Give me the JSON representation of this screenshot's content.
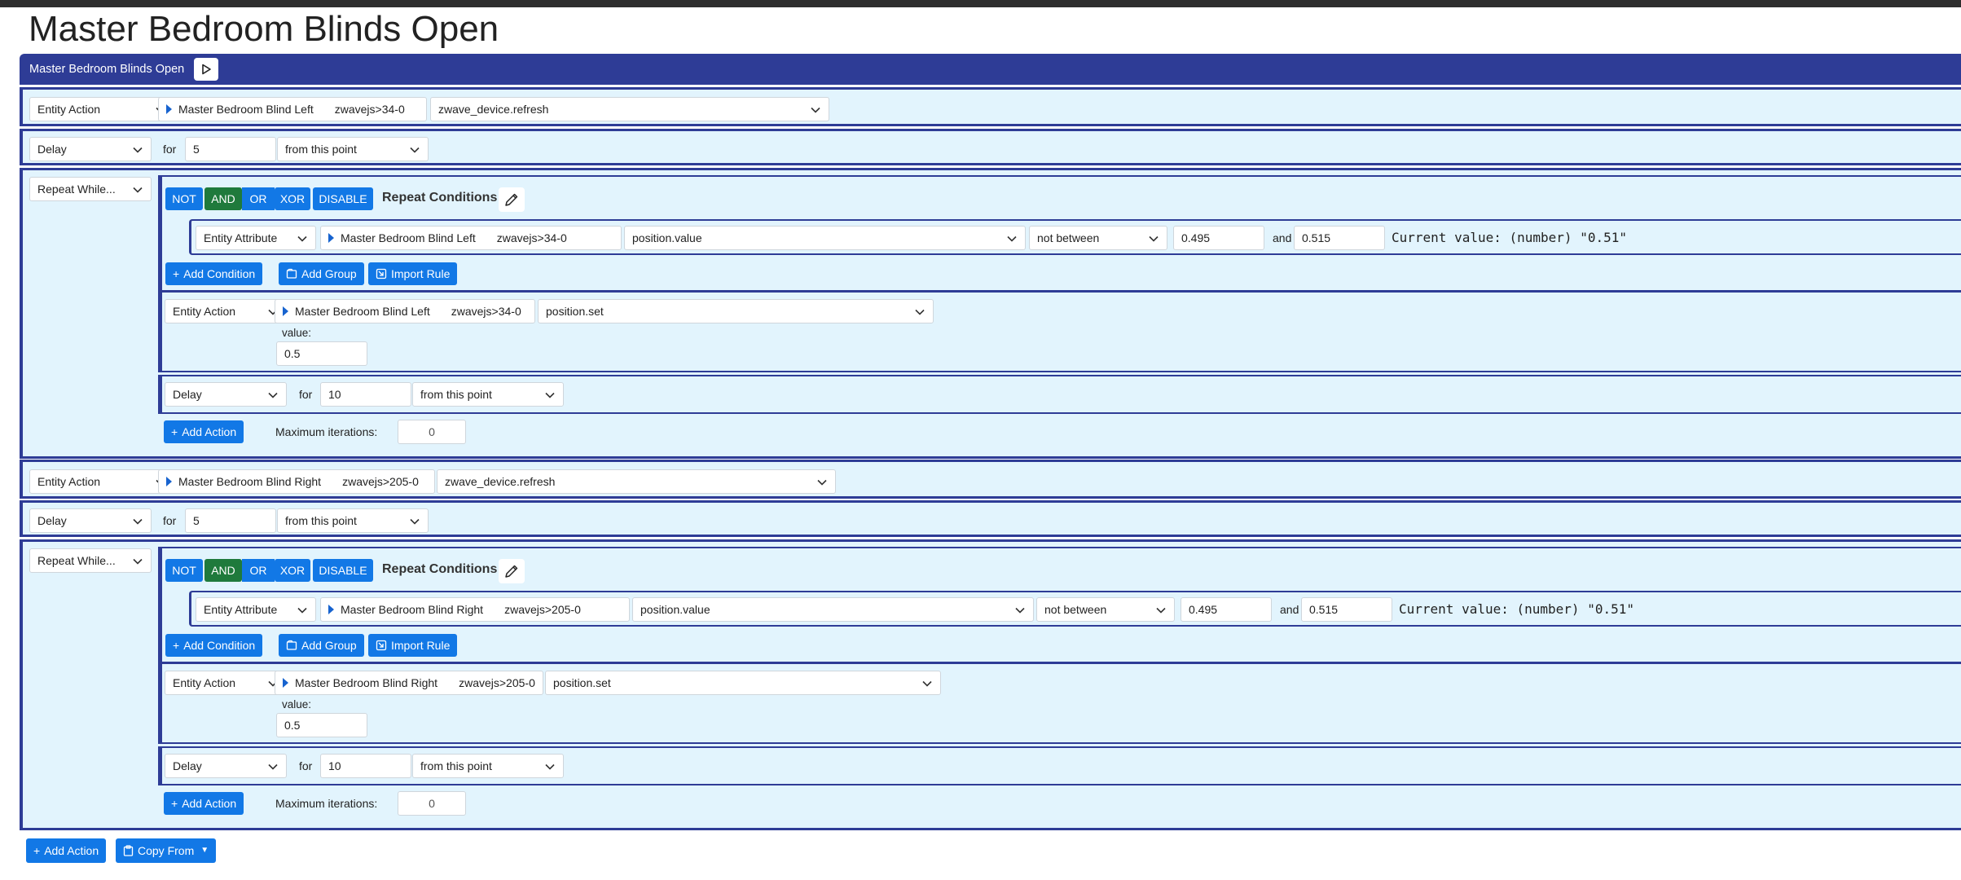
{
  "page_title": "Master Bedroom Blinds Open",
  "header": {
    "title": "Master Bedroom Blinds Open",
    "play_icon": "play-icon"
  },
  "rows": {
    "r1": {
      "type": "Entity Action",
      "entity": "Master Bedroom Blind Left",
      "entity_code": "zwavejs>34-0",
      "service": "zwave_device.refresh"
    },
    "r2": {
      "type": "Delay",
      "for_label": "for",
      "amount": "5",
      "unit": "from this point"
    },
    "r3": {
      "type": "Repeat While...",
      "ops": {
        "not": "NOT",
        "and": "AND",
        "or": "OR",
        "xor": "XOR",
        "disable": "DISABLE"
      },
      "conditions_label": "Repeat Conditions",
      "condition": {
        "type": "Entity Attribute",
        "entity": "Master Bedroom Blind Left",
        "entity_code": "zwavejs>34-0",
        "attribute": "position.value",
        "operator": "not between",
        "low": "0.495",
        "and_label": "and",
        "high": "0.515",
        "current": "Current value: (number) \"0.51\""
      },
      "add_condition": "Add Condition",
      "add_group": "Add Group",
      "import_rule": "Import Rule",
      "action": {
        "type": "Entity Action",
        "entity": "Master Bedroom Blind Left",
        "entity_code": "zwavejs>34-0",
        "service": "position.set",
        "value_label": "value:",
        "value": "0.5"
      },
      "delay": {
        "type": "Delay",
        "for_label": "for",
        "amount": "10",
        "unit": "from this point"
      },
      "add_action": "Add Action",
      "max_label": "Maximum iterations:",
      "max_value": "0"
    },
    "r4": {
      "type": "Entity Action",
      "entity": "Master Bedroom Blind Right",
      "entity_code": "zwavejs>205-0",
      "service": "zwave_device.refresh"
    },
    "r5": {
      "type": "Delay",
      "for_label": "for",
      "amount": "5",
      "unit": "from this point"
    },
    "r6": {
      "type": "Repeat While...",
      "ops": {
        "not": "NOT",
        "and": "AND",
        "or": "OR",
        "xor": "XOR",
        "disable": "DISABLE"
      },
      "conditions_label": "Repeat Conditions",
      "condition": {
        "type": "Entity Attribute",
        "entity": "Master Bedroom Blind Right",
        "entity_code": "zwavejs>205-0",
        "attribute": "position.value",
        "operator": "not between",
        "low": "0.495",
        "and_label": "and",
        "high": "0.515",
        "current": "Current value: (number) \"0.51\""
      },
      "add_condition": "Add Condition",
      "add_group": "Add Group",
      "import_rule": "Import Rule",
      "action": {
        "type": "Entity Action",
        "entity": "Master Bedroom Blind Right",
        "entity_code": "zwavejs>205-0",
        "service": "position.set",
        "value_label": "value:",
        "value": "0.5"
      },
      "delay": {
        "type": "Delay",
        "for_label": "for",
        "amount": "10",
        "unit": "from this point"
      },
      "add_action": "Add Action",
      "max_label": "Maximum iterations:",
      "max_value": "0"
    }
  },
  "footer": {
    "add_action": "Add Action",
    "copy_from": "Copy From"
  },
  "colors": {
    "header": "#2e3c96",
    "block_bg": "#e2f4fd",
    "button": "#1278e6",
    "and_button": "#1f7a3c"
  }
}
